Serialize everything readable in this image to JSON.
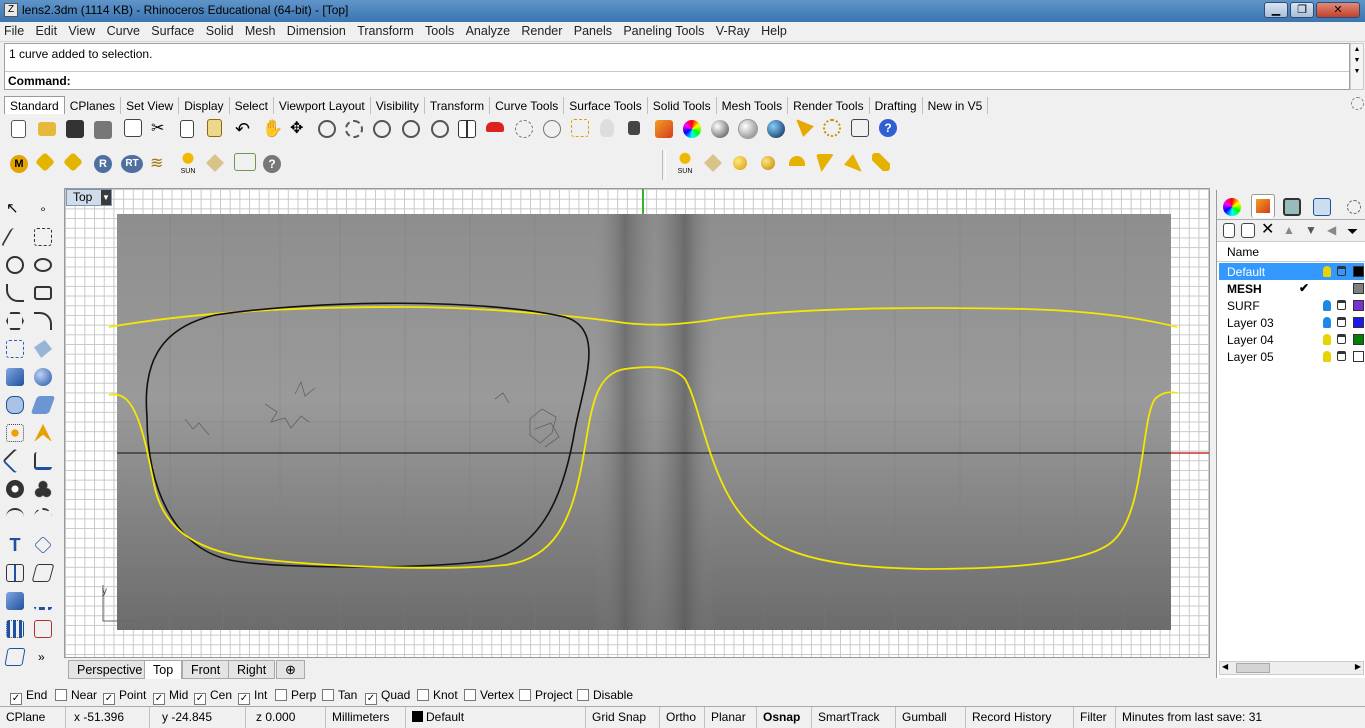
{
  "window": {
    "title": "lens2.3dm (1114 KB) - Rhinoceros Educational (64-bit) - [Top]"
  },
  "menu": [
    "File",
    "Edit",
    "View",
    "Curve",
    "Surface",
    "Solid",
    "Mesh",
    "Dimension",
    "Transform",
    "Tools",
    "Analyze",
    "Render",
    "Panels",
    "Paneling Tools",
    "V-Ray",
    "Help"
  ],
  "command": {
    "history": "1 curve added to selection.",
    "prompt": "Command:"
  },
  "toolbar_tabs": [
    "Standard",
    "CPlanes",
    "Set View",
    "Display",
    "Select",
    "Viewport Layout",
    "Visibility",
    "Transform",
    "Curve Tools",
    "Surface Tools",
    "Solid Tools",
    "Mesh Tools",
    "Render Tools",
    "Drafting",
    "New in V5"
  ],
  "vray_toolbar": {
    "m_label": "M",
    "r_label": "R",
    "rt_label": "RT",
    "sun_label": "SUN",
    "help_label": "?"
  },
  "viewport": {
    "name": "Top",
    "axis_label": "y"
  },
  "viewport_tabs": [
    "Perspective",
    "Top",
    "Front",
    "Right"
  ],
  "layers_panel": {
    "header": "Name",
    "layers": [
      {
        "name": "Default",
        "selected": true,
        "bulb": "#e8d400",
        "color": "#000000"
      },
      {
        "name": "MESH",
        "current": true,
        "check": "✔",
        "color": "#808080"
      },
      {
        "name": "SURF",
        "bulb": "#1e88e5",
        "color": "#7a2fd0"
      },
      {
        "name": "Layer 03",
        "bulb": "#1e88e5",
        "color": "#1a1aee"
      },
      {
        "name": "Layer 04",
        "bulb": "#e8d400",
        "color": "#008000"
      },
      {
        "name": "Layer 05",
        "bulb": "#e8d400",
        "color": "#ffffff"
      }
    ]
  },
  "osnaps": [
    {
      "label": "End",
      "checked": true
    },
    {
      "label": "Near",
      "checked": false
    },
    {
      "label": "Point",
      "checked": true
    },
    {
      "label": "Mid",
      "checked": true
    },
    {
      "label": "Cen",
      "checked": true
    },
    {
      "label": "Int",
      "checked": true
    },
    {
      "label": "Perp",
      "checked": false
    },
    {
      "label": "Tan",
      "checked": false
    },
    {
      "label": "Quad",
      "checked": true
    },
    {
      "label": "Knot",
      "checked": false
    },
    {
      "label": "Vertex",
      "checked": false
    },
    {
      "label": "Project",
      "checked": false
    },
    {
      "label": "Disable",
      "checked": false
    }
  ],
  "status": {
    "cplane": "CPlane",
    "x": "x -51.396",
    "y": "y -24.845",
    "z": "z 0.000",
    "units": "Millimeters",
    "layer": "Default",
    "grid_snap": "Grid Snap",
    "ortho": "Ortho",
    "planar": "Planar",
    "osnap": "Osnap",
    "smarttrack": "SmartTrack",
    "gumball": "Gumball",
    "record_history": "Record History",
    "filter": "Filter",
    "minutes": "Minutes from last save: 31"
  },
  "colors": {
    "curve_yellow": "#f5e700",
    "curve_black": "#111111",
    "selection_blue": "#3399ff",
    "x_axis": "#c83232",
    "y_axis": "#32b432"
  }
}
